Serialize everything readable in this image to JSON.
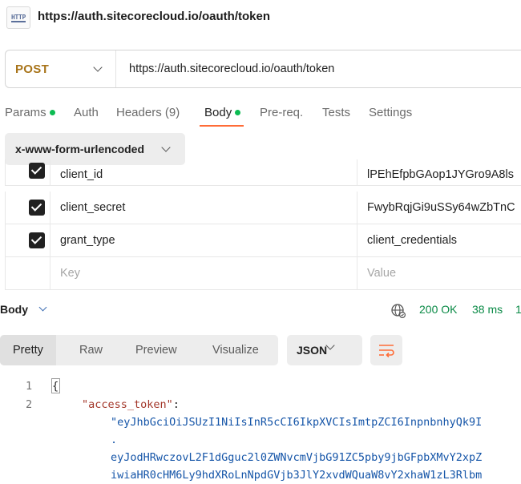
{
  "title_bar": {
    "icon_text": "HTTP",
    "url": "https://auth.sitecorecloud.io/oauth/token"
  },
  "request": {
    "method": "POST",
    "url": "https://auth.sitecorecloud.io/oauth/token"
  },
  "tabs": [
    {
      "label": "Params",
      "dot": true
    },
    {
      "label": "Auth",
      "dot": false
    },
    {
      "label": "Headers (9)",
      "dot": false
    },
    {
      "label": "Body",
      "dot": true,
      "active": true
    },
    {
      "label": "Pre-req.",
      "dot": false
    },
    {
      "label": "Tests",
      "dot": false
    },
    {
      "label": "Settings",
      "dot": false
    }
  ],
  "body_type": "x-www-form-urlencoded",
  "params": [
    {
      "key": "client_id",
      "value": "lPEhEfpbGAop1JYGro9A8ls",
      "checked": true
    },
    {
      "key": "client_secret",
      "value": "FwybRqjGi9uSSy64wZbTnC",
      "checked": true
    },
    {
      "key": "grant_type",
      "value": "client_credentials",
      "checked": true
    }
  ],
  "placeholders": {
    "key": "Key",
    "value": "Value"
  },
  "response": {
    "label": "Body",
    "status": "200 OK",
    "time": "38 ms",
    "size_prefix": "1"
  },
  "view_tabs": [
    "Pretty",
    "Raw",
    "Preview",
    "Visualize"
  ],
  "format": "JSON",
  "code": {
    "line_numbers": [
      "1",
      "2"
    ],
    "open_brace": "{",
    "key": "\"access_token\"",
    "colon": ":",
    "lines": [
      "\"eyJhbGciOiJSUzI1NiIsInR5cCI6IkpXVCIsImtpZCI6InpnbnhyQk9I",
      ".",
      "eyJodHRwczovL2F1dGguc2l0ZWNvcmVjbG91ZC5pby9jbGFpbXMvY2xpZ",
      "iwiaHR0cHM6Ly9hdXRoLnNpdGVjb3JlY2xvdWQuaW8vY2xhaW1zL3Rlbm"
    ]
  },
  "colors": {
    "method": "#a8741a",
    "active_underline": "#ff6c37",
    "tab_dot": "#0cbb52",
    "status_green": "#0a8a46",
    "json_key": "#a3372a",
    "json_string": "#1555a8"
  }
}
